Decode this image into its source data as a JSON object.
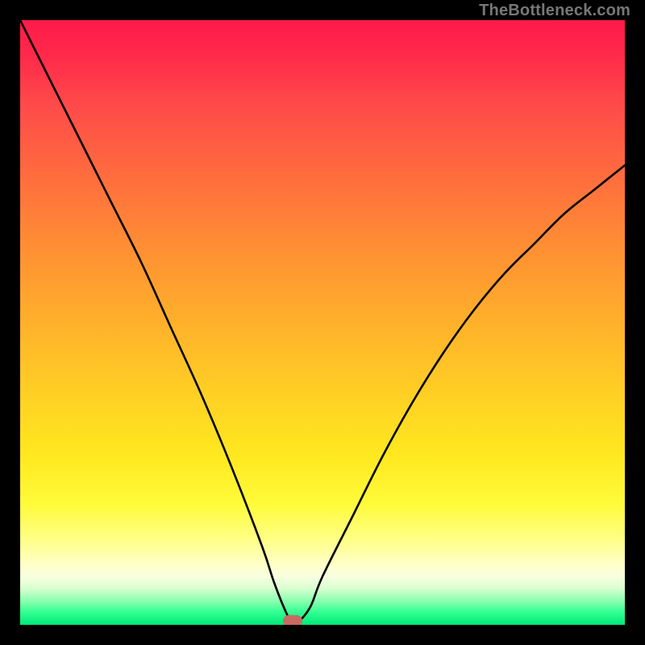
{
  "watermark": "TheBottleneck.com",
  "chart_data": {
    "type": "line",
    "title": "",
    "xlabel": "",
    "ylabel": "",
    "xlim": [
      0,
      100
    ],
    "ylim": [
      0,
      100
    ],
    "grid": false,
    "series": [
      {
        "name": "bottleneck-curve",
        "x": [
          0,
          5,
          10,
          15,
          20,
          25,
          30,
          35,
          40,
          42,
          44,
          45,
          46,
          48,
          50,
          55,
          60,
          65,
          70,
          75,
          80,
          85,
          90,
          95,
          100
        ],
        "values": [
          100,
          90,
          80,
          70,
          60,
          49,
          38,
          26,
          13,
          7,
          2,
          0.5,
          0.5,
          3,
          8,
          18,
          28,
          37,
          45,
          52,
          58,
          63,
          68,
          72,
          76
        ]
      }
    ],
    "annotations": [
      {
        "name": "optimal-marker",
        "x": 45,
        "y": 0.5
      }
    ],
    "background_gradient": {
      "top": "#ff1a4a",
      "mid": "#ffe81f",
      "bottom": "#00e878"
    }
  },
  "colors": {
    "frame": "#000000",
    "curve": "#000000",
    "marker": "#c96b63",
    "watermark": "#777777"
  }
}
